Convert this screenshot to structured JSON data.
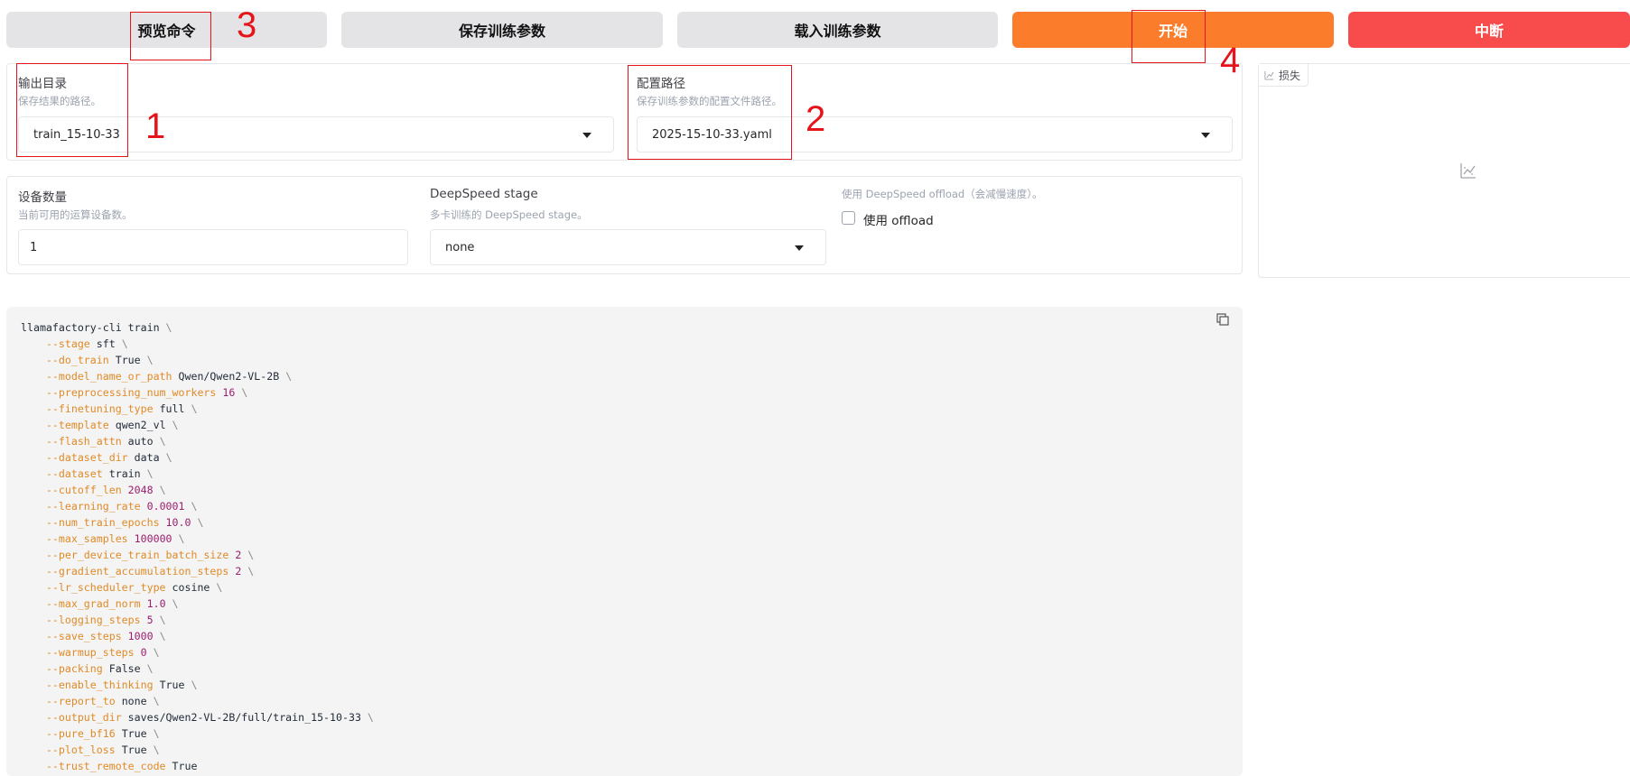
{
  "toolbar": {
    "preview_label": "预览命令",
    "save_label": "保存训练参数",
    "load_label": "载入训练参数",
    "start_label": "开始",
    "stop_label": "中断"
  },
  "output_dir": {
    "label": "输出目录",
    "info": "保存结果的路径。",
    "value": "train_15-10-33"
  },
  "config_path": {
    "label": "配置路径",
    "info": "保存训练参数的配置文件路径。",
    "value": "2025-15-10-33.yaml"
  },
  "device_count": {
    "label": "设备数量",
    "info": "当前可用的运算设备数。",
    "value": "1"
  },
  "ds_stage": {
    "label": "DeepSpeed stage",
    "info": "多卡训练的 DeepSpeed stage。",
    "value": "none"
  },
  "ds_offload": {
    "info": "使用 DeepSpeed offload（会减慢速度）。",
    "label": "使用 offload"
  },
  "loss_plot": {
    "label": "损失"
  },
  "annotations": [
    "1",
    "2",
    "3",
    "4"
  ],
  "command": {
    "lines": [
      {
        "flag": "llamafactory-cli train",
        "value": "",
        "kind": "head"
      },
      {
        "flag": "--stage",
        "value": "sft",
        "kind": "str"
      },
      {
        "flag": "--do_train",
        "value": "True",
        "kind": "str"
      },
      {
        "flag": "--model_name_or_path",
        "value": "Qwen/Qwen2-VL-2B",
        "kind": "str"
      },
      {
        "flag": "--preprocessing_num_workers",
        "value": "16",
        "kind": "num"
      },
      {
        "flag": "--finetuning_type",
        "value": "full",
        "kind": "str"
      },
      {
        "flag": "--template",
        "value": "qwen2_vl",
        "kind": "str"
      },
      {
        "flag": "--flash_attn",
        "value": "auto",
        "kind": "str"
      },
      {
        "flag": "--dataset_dir",
        "value": "data",
        "kind": "str"
      },
      {
        "flag": "--dataset",
        "value": "train",
        "kind": "str"
      },
      {
        "flag": "--cutoff_len",
        "value": "2048",
        "kind": "num"
      },
      {
        "flag": "--learning_rate",
        "value": "0.0001",
        "kind": "num"
      },
      {
        "flag": "--num_train_epochs",
        "value": "10.0",
        "kind": "num"
      },
      {
        "flag": "--max_samples",
        "value": "100000",
        "kind": "num"
      },
      {
        "flag": "--per_device_train_batch_size",
        "value": "2",
        "kind": "num"
      },
      {
        "flag": "--gradient_accumulation_steps",
        "value": "2",
        "kind": "num"
      },
      {
        "flag": "--lr_scheduler_type",
        "value": "cosine",
        "kind": "str"
      },
      {
        "flag": "--max_grad_norm",
        "value": "1.0",
        "kind": "num"
      },
      {
        "flag": "--logging_steps",
        "value": "5",
        "kind": "num"
      },
      {
        "flag": "--save_steps",
        "value": "1000",
        "kind": "num"
      },
      {
        "flag": "--warmup_steps",
        "value": "0",
        "kind": "num"
      },
      {
        "flag": "--packing",
        "value": "False",
        "kind": "str"
      },
      {
        "flag": "--enable_thinking",
        "value": "True",
        "kind": "str"
      },
      {
        "flag": "--report_to",
        "value": "none",
        "kind": "str"
      },
      {
        "flag": "--output_dir",
        "value": "saves/Qwen2-VL-2B/full/train_15-10-33",
        "kind": "str"
      },
      {
        "flag": "--pure_bf16",
        "value": "True",
        "kind": "str"
      },
      {
        "flag": "--plot_loss",
        "value": "True",
        "kind": "str"
      },
      {
        "flag": "--trust_remote_code",
        "value": "True",
        "kind": "str"
      }
    ]
  }
}
